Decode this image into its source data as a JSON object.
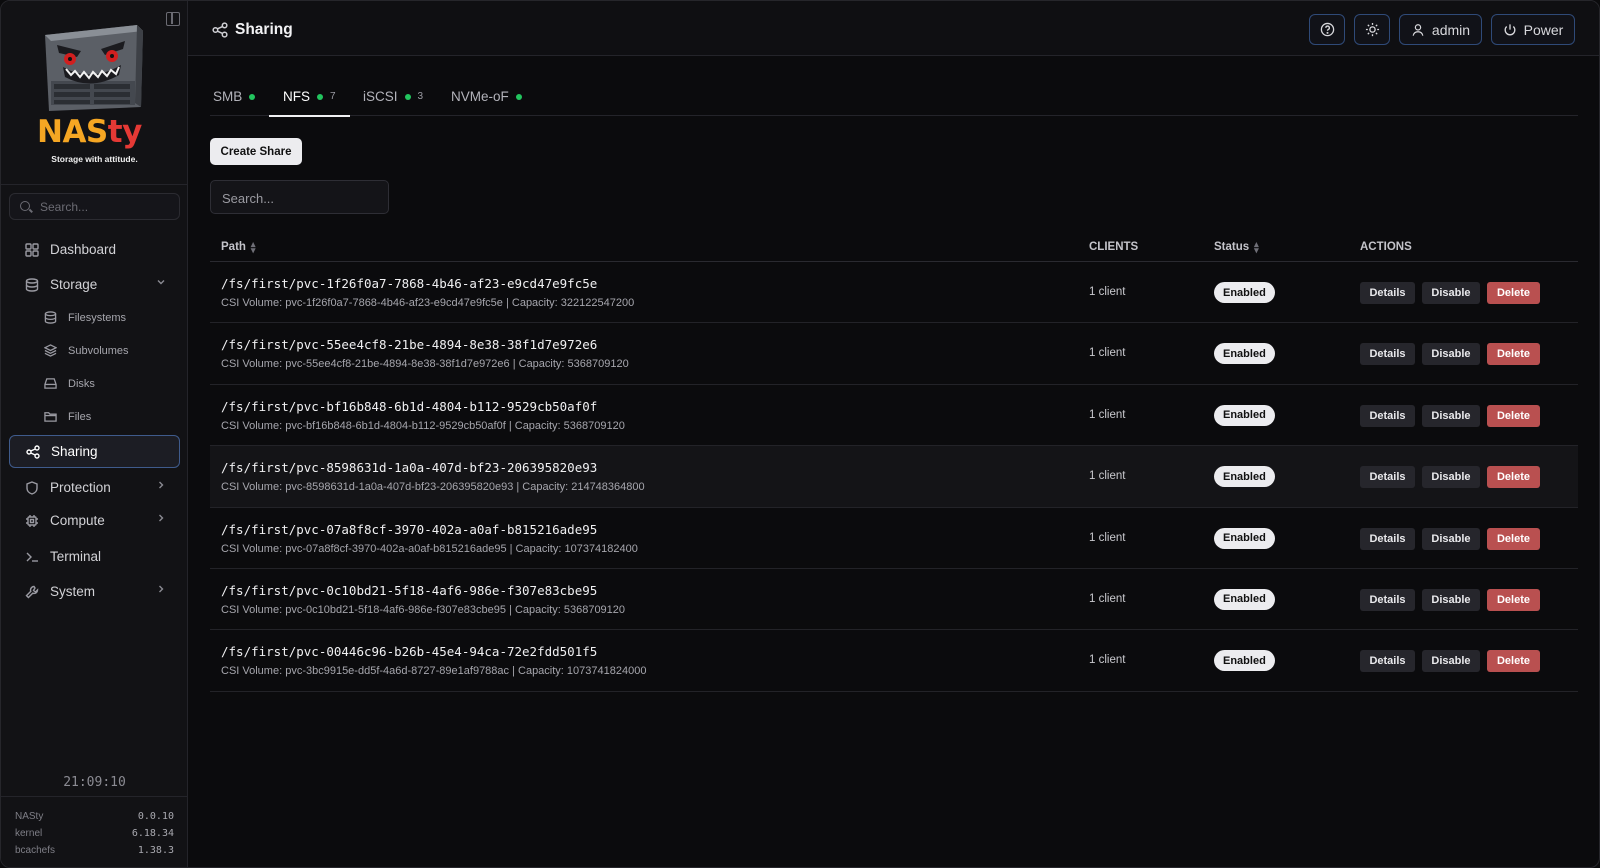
{
  "app": {
    "brand_part1": "NAS",
    "brand_part2": "ty",
    "tagline": "Storage with attitude.",
    "accent_color": "#3f5b8c",
    "brand_colors": [
      "#f5a623",
      "#e53935"
    ]
  },
  "sidebar": {
    "search_placeholder": "Search...",
    "items": [
      {
        "label": "Dashboard",
        "icon": "grid-icon"
      },
      {
        "label": "Storage",
        "icon": "database-icon",
        "expanded": true
      },
      {
        "label": "Filesystems",
        "icon": "database-icon",
        "sub": true
      },
      {
        "label": "Subvolumes",
        "icon": "layers-icon",
        "sub": true
      },
      {
        "label": "Disks",
        "icon": "hard-drive-icon",
        "sub": true
      },
      {
        "label": "Files",
        "icon": "folder-icon",
        "sub": true
      },
      {
        "label": "Sharing",
        "icon": "share-icon",
        "active": true
      },
      {
        "label": "Protection",
        "icon": "shield-icon"
      },
      {
        "label": "Compute",
        "icon": "cpu-icon"
      },
      {
        "label": "Terminal",
        "icon": "terminal-icon"
      },
      {
        "label": "System",
        "icon": "wrench-icon"
      }
    ],
    "clock": "21:09:10",
    "versions": [
      {
        "name": "NASty",
        "value": "0.0.10"
      },
      {
        "name": "kernel",
        "value": "6.18.34"
      },
      {
        "name": "bcachefs",
        "value": "1.38.3"
      }
    ]
  },
  "header": {
    "title": "Sharing",
    "user_label": "admin",
    "power_label": "Power"
  },
  "tabs": [
    {
      "label": "SMB",
      "count": ""
    },
    {
      "label": "NFS",
      "count": "7",
      "active": true
    },
    {
      "label": "iSCSI",
      "count": "3"
    },
    {
      "label": "NVMe-oF",
      "count": ""
    }
  ],
  "toolbar": {
    "create_label": "Create Share",
    "search_placeholder": "Search..."
  },
  "table": {
    "columns": {
      "path": "Path",
      "clients": "CLIENTS",
      "status": "Status",
      "actions": "ACTIONS"
    },
    "actions": {
      "details": "Details",
      "disable": "Disable",
      "delete": "Delete"
    },
    "rows": [
      {
        "path": "/fs/first/pvc-1f26f0a7-7868-4b46-af23-e9cd47e9fc5e",
        "detail": "CSI Volume: pvc-1f26f0a7-7868-4b46-af23-e9cd47e9fc5e | Capacity: 322122547200",
        "clients": "1 client",
        "status": "Enabled"
      },
      {
        "path": "/fs/first/pvc-55ee4cf8-21be-4894-8e38-38f1d7e972e6",
        "detail": "CSI Volume: pvc-55ee4cf8-21be-4894-8e38-38f1d7e972e6 | Capacity: 5368709120",
        "clients": "1 client",
        "status": "Enabled"
      },
      {
        "path": "/fs/first/pvc-bf16b848-6b1d-4804-b112-9529cb50af0f",
        "detail": "CSI Volume: pvc-bf16b848-6b1d-4804-b112-9529cb50af0f | Capacity: 5368709120",
        "clients": "1 client",
        "status": "Enabled"
      },
      {
        "path": "/fs/first/pvc-8598631d-1a0a-407d-bf23-206395820e93",
        "detail": "CSI Volume: pvc-8598631d-1a0a-407d-bf23-206395820e93 | Capacity: 214748364800",
        "clients": "1 client",
        "status": "Enabled"
      },
      {
        "path": "/fs/first/pvc-07a8f8cf-3970-402a-a0af-b815216ade95",
        "detail": "CSI Volume: pvc-07a8f8cf-3970-402a-a0af-b815216ade95 | Capacity: 107374182400",
        "clients": "1 client",
        "status": "Enabled"
      },
      {
        "path": "/fs/first/pvc-0c10bd21-5f18-4af6-986e-f307e83cbe95",
        "detail": "CSI Volume: pvc-0c10bd21-5f18-4af6-986e-f307e83cbe95 | Capacity: 5368709120",
        "clients": "1 client",
        "status": "Enabled"
      },
      {
        "path": "/fs/first/pvc-00446c96-b26b-45e4-94ca-72e2fdd501f5",
        "detail": "CSI Volume: pvc-3bc9915e-dd5f-4a6d-8727-89e1af9788ac | Capacity: 1073741824000",
        "clients": "1 client",
        "status": "Enabled"
      }
    ]
  }
}
